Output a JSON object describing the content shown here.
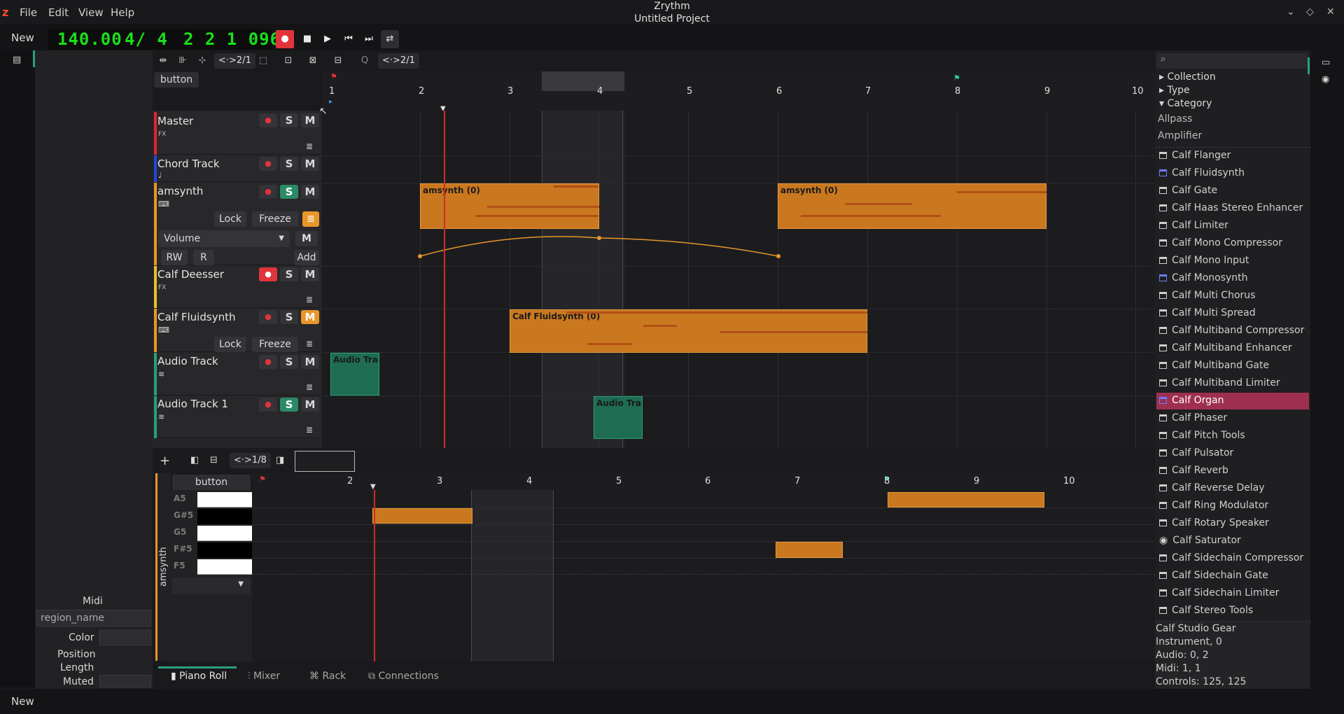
{
  "app": {
    "name": "Zrythm",
    "project": "Untitled Project"
  },
  "menu": [
    "File",
    "Edit",
    "View",
    "Help"
  ],
  "transport": {
    "new_label": "New",
    "bpm": "140.00",
    "time_sig": "4/ 4",
    "position": "2 2 1 096"
  },
  "toolbar": {
    "snap_label": "<·>2/1",
    "quantize_label": "Q",
    "quantize_value": "<·>2/1",
    "button_label": "button"
  },
  "ruler": [
    "1",
    "2",
    "3",
    "4",
    "5",
    "6",
    "7",
    "8",
    "9",
    "10"
  ],
  "tracks": [
    {
      "name": "Master",
      "color": "#e0262b",
      "sub": "FX"
    },
    {
      "name": "Chord Track",
      "color": "#2244e0",
      "sub": "♩"
    },
    {
      "name": "amsynth",
      "color": "#e8962a",
      "lock": "Lock",
      "freeze": "Freeze",
      "automation": "Volume",
      "rw": "RW",
      "r": "R",
      "add": "Add",
      "m": "M"
    },
    {
      "name": "Calf Deesser",
      "color": "#e8c02a",
      "sub": "FX"
    },
    {
      "name": "Calf Fluidsynth",
      "color": "#e8962a",
      "lock": "Lock",
      "freeze": "Freeze"
    },
    {
      "name": "Audio Track",
      "color": "#2a9e78"
    },
    {
      "name": "Audio Track 1",
      "color": "#2a9e78"
    }
  ],
  "track_buttons": {
    "solo": "S",
    "mute": "M"
  },
  "regions": {
    "r1": "amsynth (0)",
    "r2": "amsynth (0)",
    "r3": "Calf Fluidsynth (0)",
    "a1": "Audio Trac",
    "a2": "Audio Trac"
  },
  "editor": {
    "snap": "<·>1/8",
    "button_label": "button",
    "track_label": "amsynth",
    "ruler": [
      "2",
      "3",
      "4",
      "5",
      "6",
      "7",
      "8",
      "9",
      "10"
    ],
    "keys": [
      "A5",
      "G#5",
      "G5",
      "F#5",
      "F5"
    ]
  },
  "inspector": {
    "section": "Midi",
    "region_name": "region_name",
    "color_label": "Color",
    "position_label": "Position",
    "length_label": "Length",
    "muted_label": "Muted"
  },
  "bottom_tabs": [
    "Piano Roll",
    "Mixer",
    "Rack",
    "Connections"
  ],
  "browser": {
    "search_placeholder": "",
    "sections": [
      "Collection",
      "Type",
      "Category"
    ],
    "categories": [
      "Allpass",
      "Amplifier"
    ],
    "plugins": [
      "Calf Flanger",
      "Calf Fluidsynth",
      "Calf Gate",
      "Calf Haas Stereo Enhancer",
      "Calf Limiter",
      "Calf Mono Compressor",
      "Calf Mono Input",
      "Calf Monosynth",
      "Calf Multi Chorus",
      "Calf Multi Spread",
      "Calf Multiband Compressor",
      "Calf Multiband Enhancer",
      "Calf Multiband Gate",
      "Calf Multiband Limiter",
      "Calf Organ",
      "Calf Phaser",
      "Calf Pitch Tools",
      "Calf Pulsator",
      "Calf Reverb",
      "Calf Reverse Delay",
      "Calf Ring Modulator",
      "Calf Rotary Speaker",
      "Calf Saturator",
      "Calf Sidechain Compressor",
      "Calf Sidechain Gate",
      "Calf Sidechain Limiter",
      "Calf Stereo Tools"
    ],
    "selected_index": 14,
    "info": [
      "Calf Studio Gear",
      "Instrument, 0",
      "Audio: 0, 2",
      "Midi: 1, 1",
      "Controls: 125, 125"
    ]
  },
  "status": "New",
  "colors": {
    "accent": "#e8962a",
    "selected": "#9e2f51",
    "record": "#e0343c",
    "lcd": "#19e019"
  }
}
